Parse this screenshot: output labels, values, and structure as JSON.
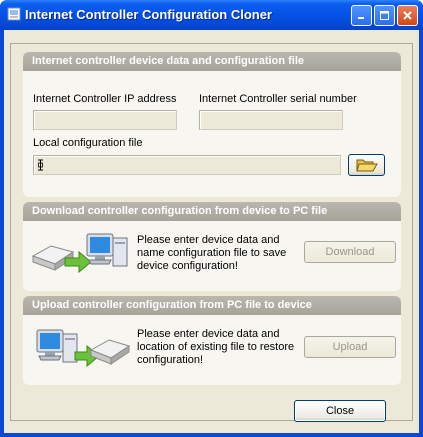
{
  "window": {
    "title": "Internet Controller Configuration Cloner",
    "min_icon": "minimize-icon",
    "max_icon": "maximize-icon",
    "close_icon": "close-icon"
  },
  "device_group": {
    "header": "Internet controller device data and configuration file",
    "ip_label": "Internet Controller IP address",
    "ip_value": "",
    "serial_label": "Internet Controller serial number",
    "serial_value": "",
    "file_label": "Local configuration file",
    "file_value": "",
    "browse_icon": "open-folder-icon"
  },
  "download_group": {
    "header": "Download controller configuration from device to PC file",
    "message": "Please enter device data and name configuration file to save device configuration!",
    "button": "Download",
    "illustration": "device-to-pc-icon"
  },
  "upload_group": {
    "header": "Upload controller configuration from PC file to device",
    "message": "Please enter device data and location of existing file to restore configuration!",
    "button": "Upload",
    "illustration": "pc-to-device-icon"
  },
  "footer": {
    "close_button": "Close"
  },
  "colors": {
    "titlebar": "#0551e6",
    "client_bg": "#ece9d8",
    "group_header": "#aeaca2"
  }
}
